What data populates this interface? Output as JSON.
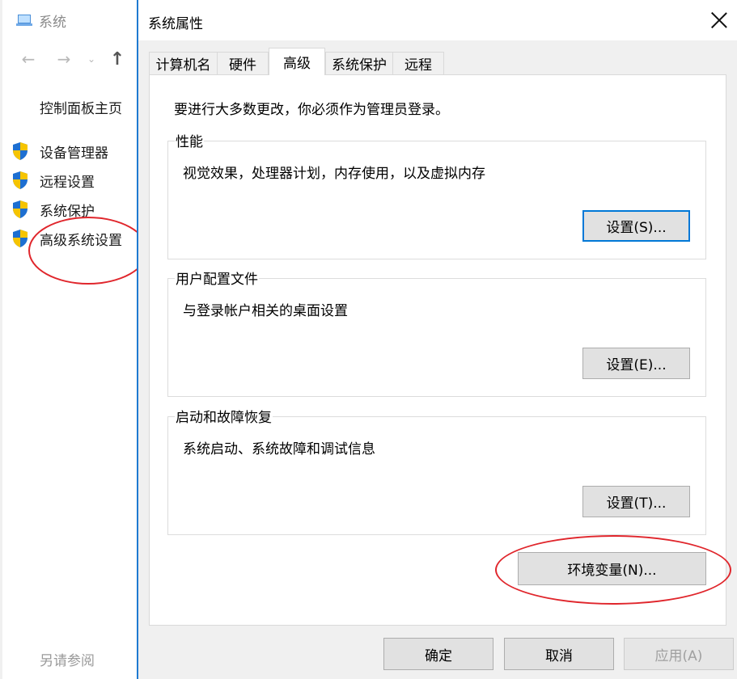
{
  "background_window": {
    "title": "系统",
    "nav": {
      "back": "←",
      "forward": "→",
      "recent": "⌄",
      "up": "↑"
    },
    "home_link": "控制面板主页",
    "items": [
      {
        "label": "设备管理器",
        "icon": "uac-shield-icon"
      },
      {
        "label": "远程设置",
        "icon": "uac-shield-icon"
      },
      {
        "label": "系统保护",
        "icon": "uac-shield-icon"
      },
      {
        "label": "高级系统设置",
        "icon": "uac-shield-icon"
      }
    ],
    "see_also": "另请参阅"
  },
  "dialog": {
    "title": "系统属性",
    "tabs": [
      {
        "label": "计算机名",
        "active": false
      },
      {
        "label": "硬件",
        "active": false
      },
      {
        "label": "高级",
        "active": true
      },
      {
        "label": "系统保护",
        "active": false
      },
      {
        "label": "远程",
        "active": false
      }
    ],
    "admin_note": "要进行大多数更改，你必须作为管理员登录。",
    "groups": [
      {
        "title": "性能",
        "desc": "视觉效果，处理器计划，内存使用，以及虚拟内存",
        "button": "设置(S)..."
      },
      {
        "title": "用户配置文件",
        "desc": "与登录帐户相关的桌面设置",
        "button": "设置(E)..."
      },
      {
        "title": "启动和故障恢复",
        "desc": "系统启动、系统故障和调试信息",
        "button": "设置(T)..."
      }
    ],
    "env_button": "环境变量(N)...",
    "ok": "确定",
    "cancel": "取消",
    "apply": "应用(A)"
  },
  "colors": {
    "annotation_circle": "#e0262c",
    "focus_border": "#0078d7",
    "dialog_border": "#1f7ad1"
  }
}
